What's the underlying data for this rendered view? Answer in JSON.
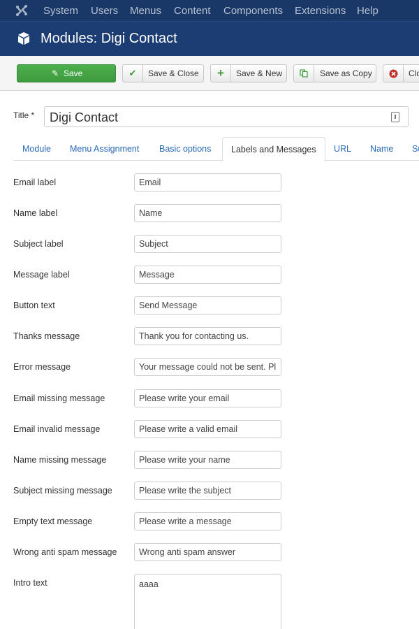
{
  "topbar": {
    "logo_icon": "joomla-logo-icon",
    "menu": [
      "System",
      "Users",
      "Menus",
      "Content",
      "Components",
      "Extensions",
      "Help"
    ]
  },
  "header": {
    "icon": "cube-icon",
    "title": "Modules: Digi Contact"
  },
  "toolbar": {
    "save": "Save",
    "save_close": "Save & Close",
    "save_new": "Save & New",
    "save_copy": "Save as Copy",
    "close": "Close"
  },
  "title_field": {
    "label": "Title *",
    "value": "Digi Contact"
  },
  "tabs": [
    {
      "label": "Module",
      "active": false
    },
    {
      "label": "Menu Assignment",
      "active": false
    },
    {
      "label": "Basic options",
      "active": false
    },
    {
      "label": "Labels and Messages",
      "active": true
    },
    {
      "label": "URL",
      "active": false
    },
    {
      "label": "Name",
      "active": false
    },
    {
      "label": "Su",
      "active": false
    }
  ],
  "fields": [
    {
      "label": "Email label",
      "value": "Email"
    },
    {
      "label": "Name label",
      "value": "Name"
    },
    {
      "label": "Subject label",
      "value": "Subject"
    },
    {
      "label": "Message label",
      "value": "Message"
    },
    {
      "label": "Button text",
      "value": "Send Message"
    },
    {
      "label": "Thanks message",
      "value": "Thank you for contacting us."
    },
    {
      "label": "Error message",
      "value": "Your message could not be sent. Pl"
    },
    {
      "label": "Email missing message",
      "value": "Please write your email"
    },
    {
      "label": "Email invalid message",
      "value": "Please write a valid email"
    },
    {
      "label": "Name missing message",
      "value": "Please write your name"
    },
    {
      "label": "Subject missing message",
      "value": "Please write the subject"
    },
    {
      "label": "Empty text message",
      "value": "Please write a message"
    },
    {
      "label": "Wrong anti spam message",
      "value": "Wrong anti spam answer"
    }
  ],
  "intro_text": {
    "label": "Intro text",
    "value": "aaaa"
  },
  "colors": {
    "topbar": "#1a3867",
    "header": "#1c3d74",
    "save_button": "#46a546",
    "link": "#2a69b8"
  }
}
